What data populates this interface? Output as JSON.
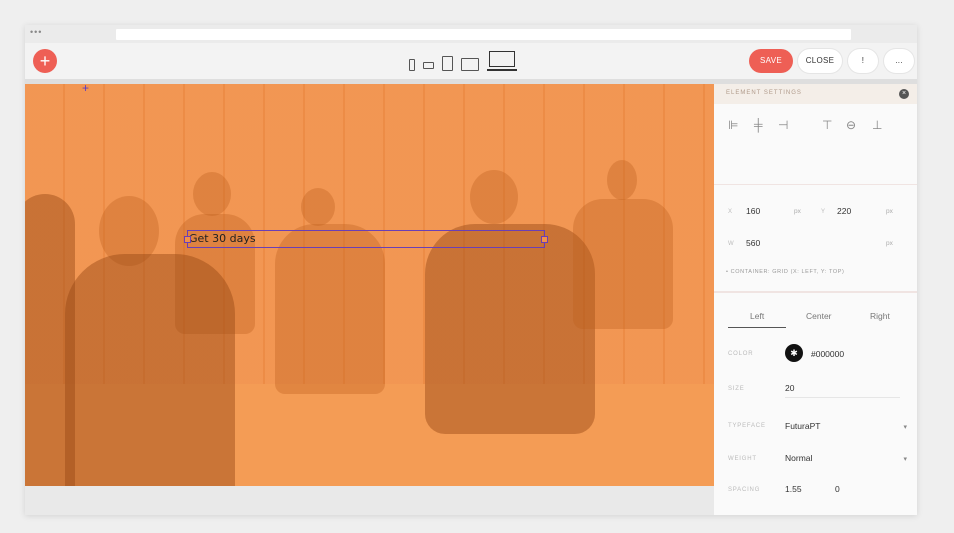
{
  "window": {
    "dots": "•••"
  },
  "toolbar": {
    "add_icon": "+",
    "devices": [
      "phone-portrait",
      "phone-landscape",
      "tablet-portrait",
      "tablet-landscape",
      "laptop"
    ],
    "save_label": "SAVE",
    "close_label": "CLOSE",
    "info_label": "!",
    "more_label": "...",
    "accent": "#ee5f55"
  },
  "canvas": {
    "background": "#f1914a",
    "text_element": "Get 30 days",
    "crosshair": "+"
  },
  "panel": {
    "title": "ELEMENT SETTINGS",
    "close_icon": "×",
    "x_label": "X",
    "x_value": "160",
    "x_unit": "px",
    "y_label": "Y",
    "y_value": "220",
    "y_unit": "px",
    "w_label": "W",
    "w_value": "560",
    "w_unit": "px",
    "container_info": "• CONTAINER: GRID (X: LEFT, Y: TOP)",
    "tabs": [
      "Left",
      "Center",
      "Right"
    ],
    "color_label": "COLOR",
    "color_value": "#000000",
    "size_label": "SIZE",
    "size_value": "20",
    "typeface_label": "TYPEFACE",
    "typeface_value": "FuturaPT",
    "weight_label": "WEIGHT",
    "weight_value": "Normal",
    "spacing_label": "SPACING",
    "spacing_value": "1.55",
    "spacing_value2": "0",
    "chevron": "▾"
  }
}
